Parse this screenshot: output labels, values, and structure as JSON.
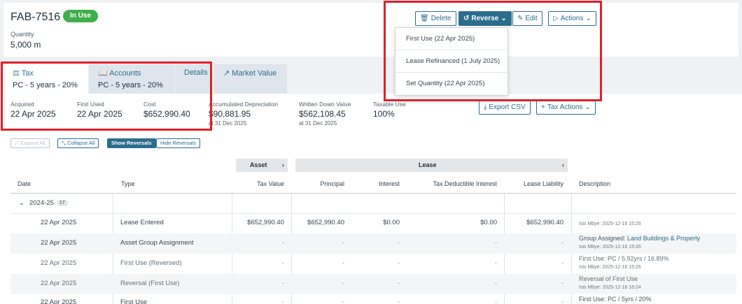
{
  "asset": {
    "id": "FAB-7516",
    "status": "In Use",
    "quantity_label": "Quantity",
    "quantity_value": "5,000 m"
  },
  "toolbar": {
    "delete": "Delete",
    "reverse": "Reverse",
    "edit": "Edit",
    "actions": "Actions"
  },
  "reverse_menu": [
    "First Use (22 Apr 2025)",
    "Lease Refinanced (1 July 2025)",
    "Set Quantity (22 Apr 2025)"
  ],
  "tabs": [
    {
      "label": "Tax",
      "sub": "PC - 5 years - 20%"
    },
    {
      "label": "Accounts",
      "sub": "PC - 5 years - 20%"
    },
    {
      "label": "Details",
      "sub": ""
    },
    {
      "label": "Market Value",
      "sub": ""
    }
  ],
  "stats": {
    "acquired_label": "Acquired",
    "acquired": "22 Apr 2025",
    "first_used_label": "First Used",
    "first_used": "22 Apr 2025",
    "cost_label": "Cost",
    "cost": "$652,990.40",
    "acc_dep_label": "Accumulated Depreciation",
    "acc_dep": "$90,881.95",
    "acc_dep_sub": "at 31 Dec 2025",
    "wdv_label": "Written Down Value",
    "wdv": "$562,108.45",
    "wdv_sub": "at 31 Dec 2025",
    "taxable_label": "Taxable Use",
    "taxable": "100%"
  },
  "controls": {
    "export_csv": "Export CSV",
    "tax_actions": "Tax Actions",
    "expand_all": "Expand All",
    "collapse_all": "Collapse All",
    "show_reversals": "Show Reversals",
    "hide_reversals": "Hide Reversals"
  },
  "groups": {
    "asset": "Asset",
    "lease": "Lease"
  },
  "columns": {
    "date": "Date",
    "type": "Type",
    "tax_value": "Tax Value",
    "principal": "Principal",
    "interest": "Interest",
    "tax_ded_interest": "Tax Deductible Interest",
    "lease_liability": "Lease Liability",
    "description": "Description"
  },
  "year_group": {
    "label": "2024-25",
    "count": "17"
  },
  "rows": [
    {
      "date": "22 Apr 2025",
      "type": "Lease Entered",
      "tax_value": "$652,990.40",
      "principal": "$652,990.40",
      "interest": "$0.00",
      "tax_ded_interest": "$0.00",
      "lease_liability": "$652,990.40",
      "desc": "",
      "desc_link": "",
      "meta": "Isis Mbye: 2025-12-16 15:26"
    },
    {
      "date": "22 Apr 2025",
      "type": "Asset Group Assignment",
      "tax_value": "-",
      "principal": "-",
      "interest": "-",
      "tax_ded_interest": "-",
      "lease_liability": "-",
      "desc": "Group Assigned: ",
      "desc_link": "Land Buildings & Property",
      "meta": "Isis Mbye: 2025-12-16 15:26"
    },
    {
      "date": "22 Apr 2025",
      "type": "First Use (Reversed)",
      "tax_value": "-",
      "principal": "-",
      "interest": "-",
      "tax_ded_interest": "-",
      "lease_liability": "-",
      "desc": "First Use: PC / 5.92yrs / 16.89%",
      "desc_link": "",
      "meta": "Isis Mbye: 2025-12-16 15:26"
    },
    {
      "date": "22 Apr 2025",
      "type": "Reversal (First Use)",
      "tax_value": "-",
      "principal": "-",
      "interest": "-",
      "tax_ded_interest": "-",
      "lease_liability": "-",
      "desc": "Reversal of First Use",
      "desc_link": "",
      "meta": "Isis Mbye: 2025-12-16 16:24"
    },
    {
      "date": "22 Apr 2025",
      "type": "First Use",
      "tax_value": "-",
      "principal": "-",
      "interest": "-",
      "tax_ded_interest": "-",
      "lease_liability": "-",
      "desc": "First Use: PC / 5yrs / 20%",
      "desc_link": "",
      "meta": ""
    }
  ]
}
